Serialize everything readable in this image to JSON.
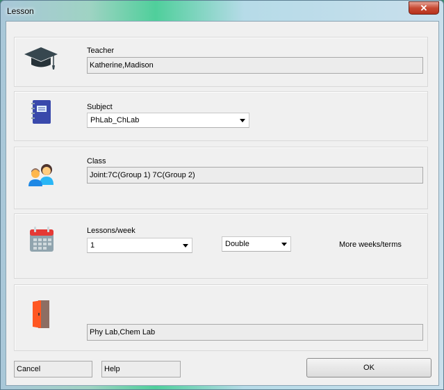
{
  "window": {
    "title": "Lesson",
    "close_glyph": "✕"
  },
  "teacher": {
    "label": "Teacher",
    "value": "Katherine,Madison",
    "icon": "graduation-cap-icon"
  },
  "subject": {
    "label": "Subject",
    "value": "PhLab_ChLab",
    "icon": "notebook-icon"
  },
  "class": {
    "label": "Class",
    "value": "Joint:7C(Group 1) 7C(Group 2)",
    "icon": "people-icon"
  },
  "lessons": {
    "label": "Lessons/week",
    "count_value": "1",
    "length_value": "Double",
    "more_link": "More weeks/terms",
    "icon": "calendar-icon"
  },
  "room": {
    "value": "Phy Lab,Chem Lab",
    "icon": "door-icon"
  },
  "footer": {
    "cancel_label": "Cancel",
    "help_label": "Help",
    "ok_label": "OK"
  }
}
